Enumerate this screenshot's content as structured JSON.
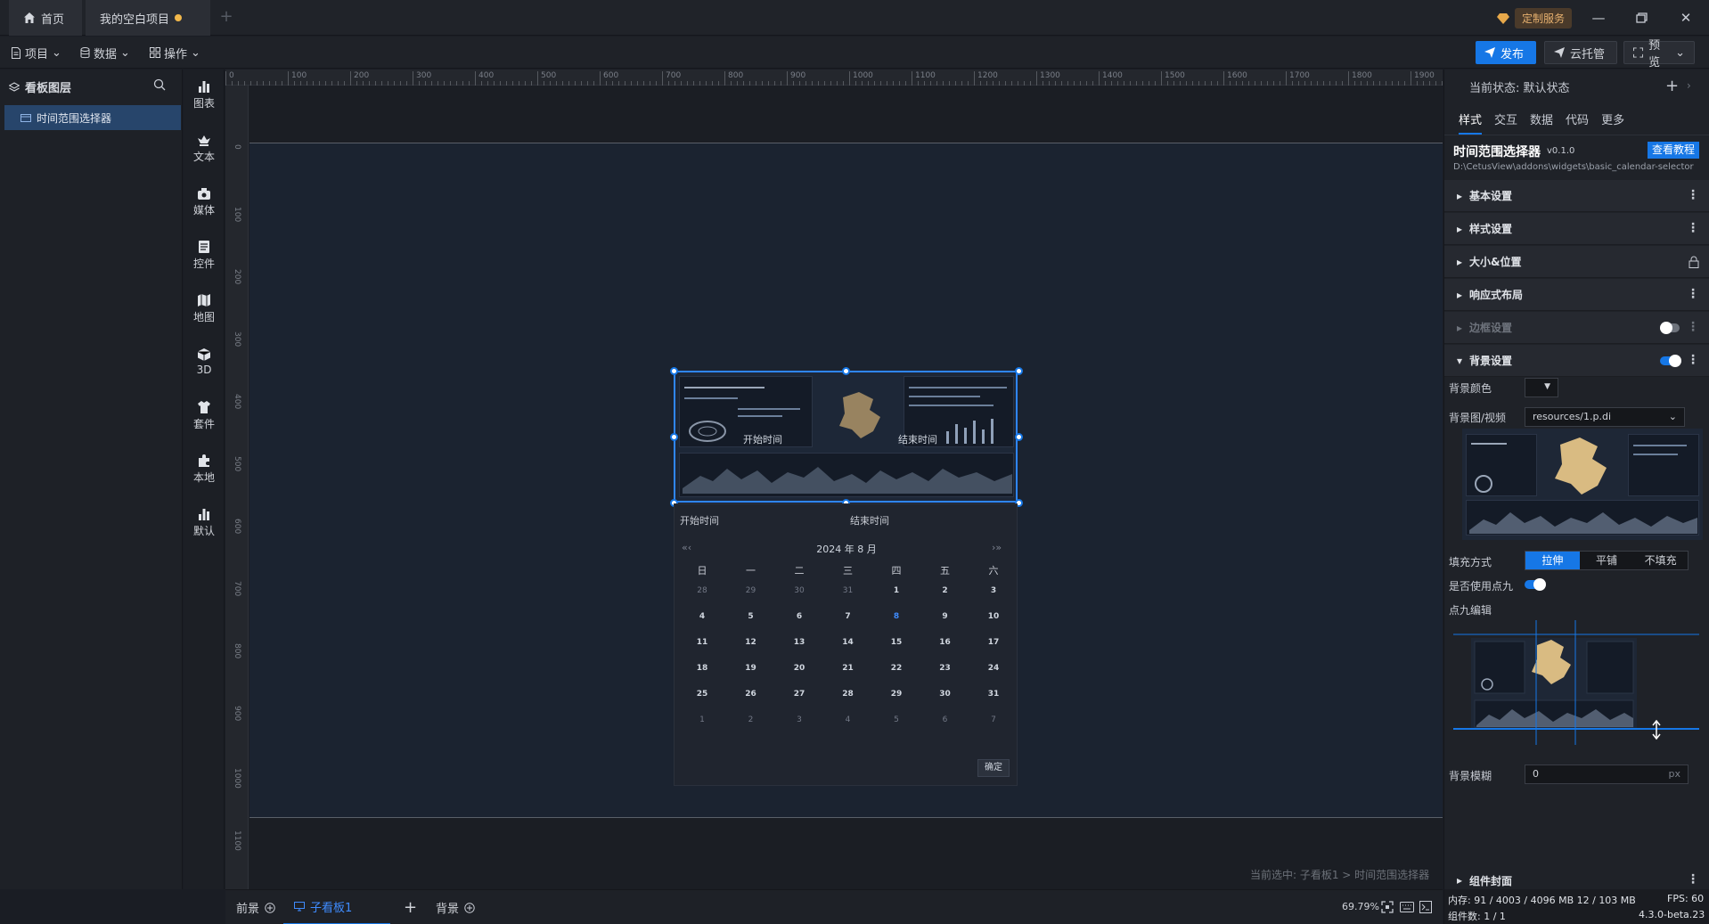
{
  "tabs": {
    "home": "首页",
    "project": "我的空白项目",
    "vip": "定制服务"
  },
  "menubar": {
    "project": "项目",
    "data": "数据",
    "operate": "操作",
    "publish": "发布",
    "cloud": "云托管",
    "preview": "预览"
  },
  "layers": {
    "title": "看板图层",
    "item": "时间范围选择器"
  },
  "components": [
    "图表",
    "文本",
    "媒体",
    "控件",
    "地图",
    "3D",
    "套件",
    "本地",
    "默认"
  ],
  "ruler": {
    "top": [
      "0",
      "100",
      "200",
      "300",
      "400",
      "500",
      "600",
      "700",
      "800",
      "900",
      "1000",
      "1100",
      "1200",
      "1300",
      "1400",
      "1500",
      "1600",
      "1700",
      "1800",
      "1900"
    ],
    "left": [
      "0",
      "100",
      "200",
      "300",
      "400",
      "500",
      "600",
      "700",
      "800",
      "900",
      "1000",
      "1100"
    ]
  },
  "widget": {
    "start_label": "开始时间",
    "end_label": "结束时间",
    "calendar": {
      "start": "开始时间",
      "end": "结束时间",
      "title": "2024 年 8 月",
      "nav_prev": "«‹",
      "nav_next": "›»",
      "weekdays": [
        "日",
        "一",
        "二",
        "三",
        "四",
        "五",
        "六"
      ],
      "weeks": [
        [
          "28",
          "29",
          "30",
          "31",
          "1",
          "2",
          "3"
        ],
        [
          "4",
          "5",
          "6",
          "7",
          "8",
          "9",
          "10"
        ],
        [
          "11",
          "12",
          "13",
          "14",
          "15",
          "16",
          "17"
        ],
        [
          "18",
          "19",
          "20",
          "21",
          "22",
          "23",
          "24"
        ],
        [
          "25",
          "26",
          "27",
          "28",
          "29",
          "30",
          "31"
        ],
        [
          "1",
          "2",
          "3",
          "4",
          "5",
          "6",
          "7"
        ]
      ],
      "highlight": "8",
      "ok": "确定"
    }
  },
  "canvas": {
    "selection_info": "当前选中: 子看板1 > 时间范围选择器"
  },
  "bottombar": {
    "foreground": "前景",
    "child": "子看板1",
    "background": "背景",
    "zoom": "69.79%"
  },
  "props": {
    "state": "当前状态:  默认状态",
    "tabs": [
      "样式",
      "交互",
      "数据",
      "代码",
      "更多"
    ],
    "widget_name": "时间范围选择器",
    "widget_version": "v0.1.0",
    "tutorial": "查看教程",
    "path": "D:\\CetusView\\addons\\widgets\\basic_calendar-selector",
    "sections": {
      "basic": "基本设置",
      "style": "样式设置",
      "size": "大小&位置",
      "responsive": "响应式布局",
      "border": "边框设置",
      "background": "背景设置"
    },
    "bg_color_label": "背景颜色",
    "bg_image_label": "背景图/视频",
    "bg_image_value": "resources/1.p.di",
    "fill_label": "填充方式",
    "fill_options": [
      "拉伸",
      "平铺",
      "不填充"
    ],
    "nine_label": "是否使用点九",
    "nine_edit_label": "点九编辑",
    "blur_label": "背景模糊",
    "blur_value": "0",
    "blur_unit": "px",
    "cover": "组件封面",
    "status": {
      "memory": "内存:  91 / 4003 / 4096 MB  12 / 103 MB",
      "fps": "FPS:  60",
      "count": "组件数: 1 / 1",
      "version": "4.3.0-beta.23"
    }
  }
}
